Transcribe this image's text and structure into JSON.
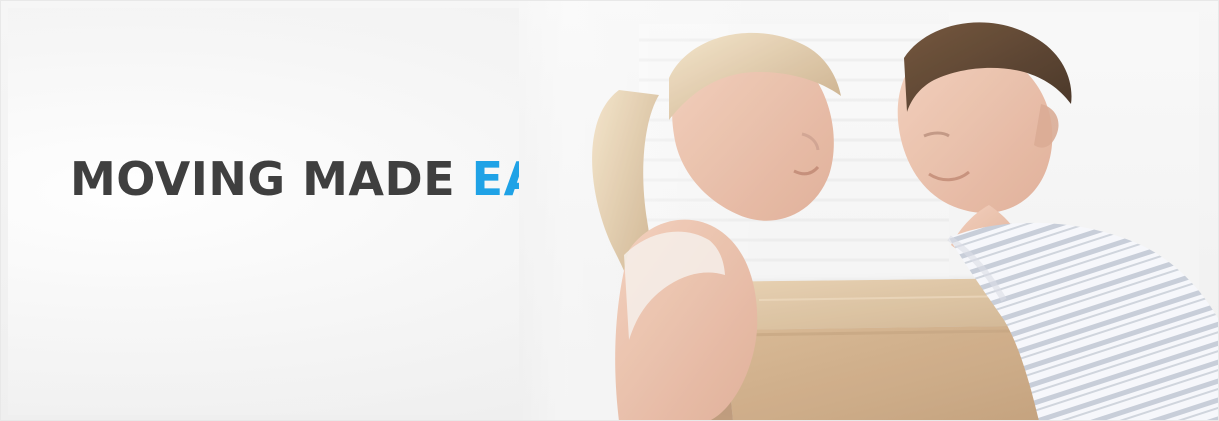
{
  "hero": {
    "headline": {
      "part1": "MOVING MADE",
      "part2": "EASY"
    },
    "colors": {
      "headline_dark": "#3f3f3f",
      "headline_accent": "#1fa2e6",
      "background": "#f3f3f3"
    }
  }
}
